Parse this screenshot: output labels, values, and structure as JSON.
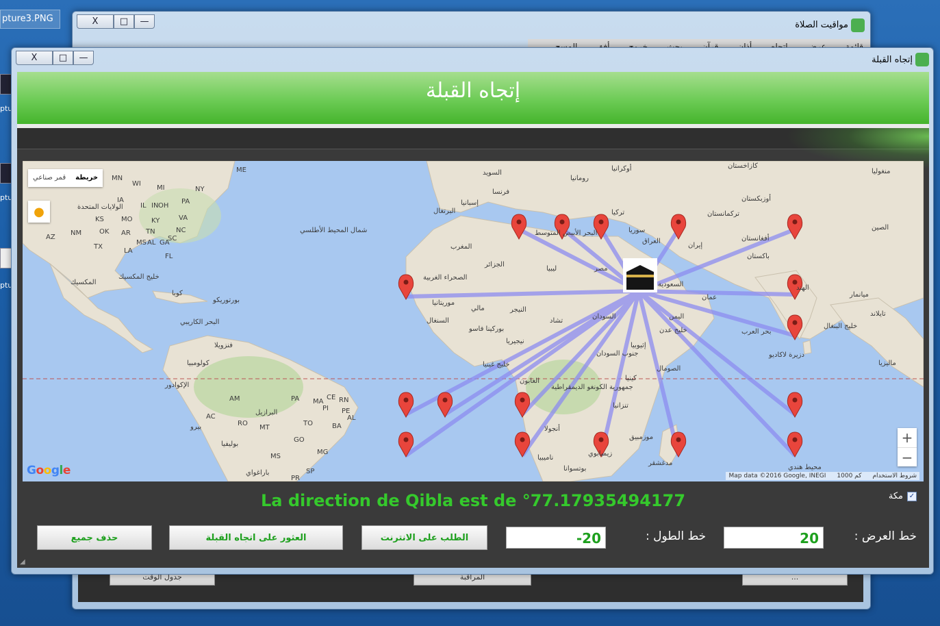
{
  "desktop": {
    "file_label": "pture3.PNG",
    "side_labels": [
      "ptu",
      "ptu",
      "ptu"
    ]
  },
  "back_window": {
    "title": "مواقيت الصلاة",
    "menu": [
      "قائمة",
      "عرض",
      "اتجاه",
      "أذان",
      "قرآن",
      "بحث",
      "خروج",
      "أفق",
      "المسح"
    ],
    "buttons": [
      "جدول الوقت",
      "المراقبة",
      "..."
    ]
  },
  "front_window": {
    "title": "إتجاه القبلة",
    "header_title": "إتجاه القبلة",
    "controls": {
      "close": "X",
      "max": "□",
      "min": "—"
    }
  },
  "map": {
    "maptype": {
      "map": "خريطة",
      "satellite": "قمر صناعي"
    },
    "zoom": {
      "in": "+",
      "out": "−"
    },
    "logo": "Google",
    "attribution": {
      "data": "Map data ©2016 Google, INEGI",
      "scale": "1000 كم",
      "terms": "شروط الاستخدام"
    },
    "labels": {
      "usa": "الولايات المتحدة",
      "mexico": "المكسيك",
      "gulf_mexico": "خليج المكسيك",
      "cuba": "كوبا",
      "puerto_rico": "بورتوريكو",
      "caribbean": "البحر الكاريبي",
      "north_atlantic": "شمال المحيط الأطلسي",
      "venezuela": "فنزويلا",
      "colombia": "كولومبيا",
      "ecuador": "الإكوادور",
      "peru": "بيرو",
      "brazil": "البرازيل",
      "bolivia": "بوليفيا",
      "paraguay": "باراغواي",
      "sweden": "السويد",
      "ukraine": "أوكرانيا",
      "france": "فرنسا",
      "spain": "إسبانيا",
      "romania": "رومانيا",
      "turkey": "تركيا",
      "kazakhstan": "كازاخستان",
      "mongolia": "منغوليا",
      "uzbekistan": "أوزبكستان",
      "turkmenistan": "تركمانستان",
      "china": "الصين",
      "afghanistan": "أفغانستان",
      "pakistan": "باكستان",
      "iran": "إيران",
      "iraq": "العراق",
      "syria": "سوريا",
      "india": "الهند",
      "myanmar": "ميانمار",
      "thailand": "تايلاند",
      "bay_bengal": "خليج البنغال",
      "arabian_sea": "بحر العرب",
      "maldives": "دزيرة لاكاديو",
      "med_sea": "البحر الأبيض المتوسط",
      "morocco": "المغرب",
      "algeria": "الجزائر",
      "libya": "ليبيا",
      "egypt": "مصر",
      "w_sahara": "الصحراء الغربية",
      "mauritania": "موريتانيا",
      "mali": "مالي",
      "niger": "النيجر",
      "chad": "تشاد",
      "sudan": "السودان",
      "nigeria": "نيجيريا",
      "ethiopia": "إثيوبيا",
      "south_sudan": "جنوب السودان",
      "somalia": "الصومال",
      "kenya": "كينيا",
      "tanzania": "تنزانيا",
      "drc": "جمهورية الكونغو الديمقراطية",
      "angola": "أنجولا",
      "namibia": "ناميبيا",
      "botswana": "بوتسوانا",
      "zimbabwe": "زيمبابوي",
      "mozambique": "موزمبيق",
      "madagascar": "مدغشقر",
      "indian_ocean": "محيط هندي",
      "gulf_guinea": "خليج غينيا",
      "gulf_aden": "خليج عدن",
      "yemen": "اليمن",
      "gabon": "الغابون",
      "malaysia": "ماليزيا",
      "portugal": "البرتغال",
      "senegal": "السنغال",
      "burkina": "بوركينا فاسو",
      "mecca_area": "السعودية",
      "oman": "عمان"
    },
    "state_codes": [
      "MN",
      "WI",
      "MI",
      "NY",
      "IA",
      "IL",
      "IN",
      "OH",
      "PA",
      "MO",
      "KY",
      "VA",
      "KS",
      "OK",
      "AR",
      "TN",
      "NC",
      "SC",
      "TX",
      "LA",
      "MS",
      "AL",
      "GA",
      "FL",
      "NM",
      "AZ",
      "ME"
    ],
    "sa_codes": [
      "AM",
      "PA",
      "CE",
      "MA",
      "PI",
      "RN",
      "PE",
      "AL",
      "BA",
      "TO",
      "MT",
      "GO",
      "MS",
      "MG",
      "SP",
      "PR",
      "RO",
      "AC"
    ]
  },
  "status": {
    "direction_text": "La direction de Qibla est de °77.17935494177",
    "mecca_label": "مكة",
    "mecca_checked": "✓"
  },
  "form": {
    "lat_label": "خط العرض :",
    "lat_value": "20",
    "lon_label": "خط الطول :",
    "lon_value": "-20",
    "btn_online": "الطلب على الانترنت",
    "btn_find": "العثور على اتجاه القبلة",
    "btn_clear": "حذف جميع"
  },
  "colors": {
    "header_green": "#6ccb55",
    "text_green": "#35c92c",
    "field_green": "#1ea01e",
    "pin_red": "#e8453c",
    "qibla_line": "#8c8cf0"
  },
  "chart_data": {
    "qibla_center": {
      "name": "Mecca"
    },
    "markers": 15
  }
}
